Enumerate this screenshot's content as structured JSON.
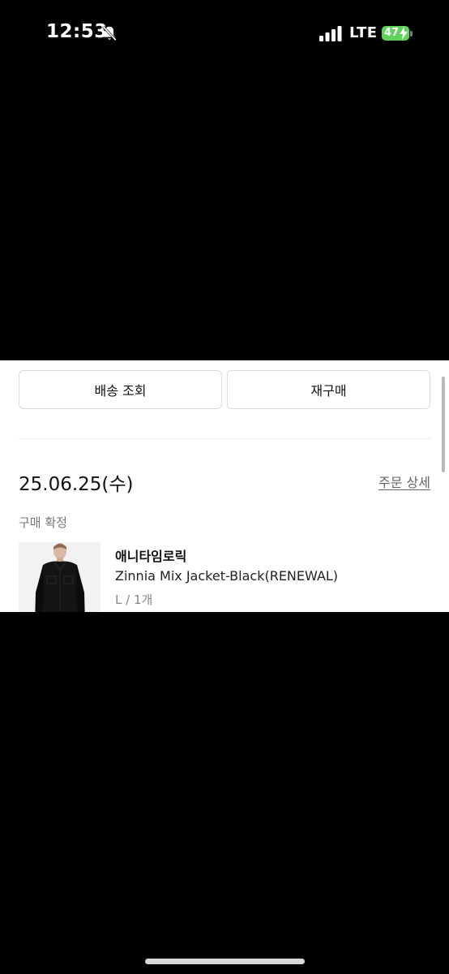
{
  "status_bar": {
    "time": "12:53",
    "network": "LTE",
    "battery_level": "47"
  },
  "actions": {
    "track_label": "배송 조회",
    "rebuy_label": "재구매"
  },
  "order": {
    "date": "25.06.25(수)",
    "detail_link": "주문 상세",
    "status": "구매 확정",
    "item": {
      "brand": "애니타임로릭",
      "name": "Zinnia Mix Jacket-Black(RENEWAL)",
      "option": "L / 1개"
    }
  },
  "colors": {
    "background": "#000000",
    "panel": "#ffffff",
    "battery": "#5fd35b"
  },
  "icons": [
    "bell-slash-icon",
    "signal-icon",
    "battery-icon",
    "bolt-icon"
  ]
}
